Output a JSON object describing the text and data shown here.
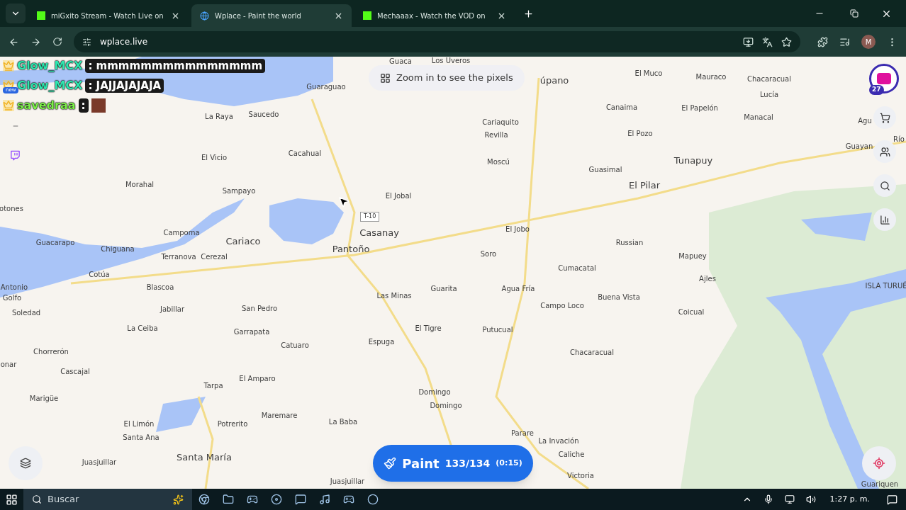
{
  "tabs": [
    {
      "label": "miGxito Stream - Watch Live on",
      "selected": false,
      "kind": "kick"
    },
    {
      "label": "Wplace - Paint the world",
      "selected": true,
      "kind": "globe"
    },
    {
      "label": "Mechaaax - Watch the VOD on",
      "selected": false,
      "kind": "kick"
    }
  ],
  "address": "wplace.live",
  "profile_initial": "M",
  "chat": [
    {
      "user": "Glow_MCX",
      "color": "#2ee6b0",
      "message": ": mmmmmmmmmmmmmmm"
    },
    {
      "user": "Glow_MCX",
      "color": "#2ee6b0",
      "message": ": JAJJAJAJAJA",
      "new_badge": "new"
    },
    {
      "user": "savedraa",
      "color": "#7cf04a",
      "message": ":",
      "emote": true
    }
  ],
  "zoom_hint": "Zoom in to see the pixels",
  "avatar_badge": "27",
  "road_sign": "T-10",
  "places": [
    "Guaca",
    "Los Uveros",
    "Guaraguao",
    "úpano",
    "El Muco",
    "Mauraco",
    "Chacaracual",
    "Lucía",
    "La Raya",
    "Saucedo",
    "Cariaquito",
    "Canaima",
    "El Papelón",
    "Manacal",
    "Agu",
    "Revilla",
    "El Pozo",
    "Río",
    "Guayan",
    "El Vicio",
    "Cacahual",
    "Moscú",
    "Guasimal",
    "Tunapuy",
    "El Pilar",
    "Morahal",
    "Sampayo",
    "El Jobal",
    "otones",
    "Casanay",
    "El Jobo",
    "Guacarapo",
    "Campoma",
    "Cariaco",
    "Russian",
    "Chiguana",
    "Pantoño",
    "Terranova",
    "Cerezal",
    "Soro",
    "Mapuey",
    "Cumacatal",
    "Cotúa",
    "Ajles",
    "Antonio",
    "Golfo",
    "Blascoa",
    "Las Minas",
    "Guarita",
    "Agua Fría",
    "Buena Vista",
    "ISLA TURUÉ",
    "Campo Loco",
    "Soledad",
    "Jabillar",
    "San Pedro",
    "Coicual",
    "La Ceiba",
    "Garrapata",
    "El Tigre",
    "Putucual",
    "Chorrerón",
    "Catuaro",
    "Espuga",
    "Chacaracual",
    "onar",
    "Cascajal",
    "Tarpa",
    "El Amparo",
    "Domingo",
    "Maremare",
    "Domingo",
    "Marigüe",
    "El Limón",
    "Potrerito",
    "La Baba",
    "Santa Ana",
    "Parare",
    "La Invación",
    "Caliche",
    "Santa María",
    "Juasjuillar",
    "Victoria",
    "Juasjuillar",
    "Guariquen"
  ],
  "paint": {
    "label": "Paint",
    "count": "133/134",
    "timer": "(0:15)"
  },
  "taskbar": {
    "search_placeholder": "Buscar",
    "time": "1:27 p. m."
  }
}
